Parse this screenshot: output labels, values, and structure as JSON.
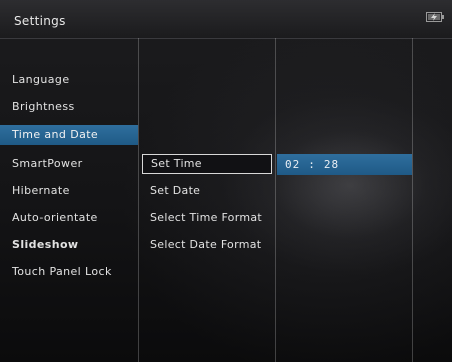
{
  "header": {
    "title": "Settings",
    "battery_icon": "battery-charging-icon"
  },
  "menu": {
    "items": [
      {
        "label": "Language"
      },
      {
        "label": "Brightness"
      },
      {
        "label": "Time and Date",
        "selected": true
      },
      {
        "label": "SmartPower"
      },
      {
        "label": "Hibernate"
      },
      {
        "label": "Auto-orientate"
      },
      {
        "label": "Slideshow"
      },
      {
        "label": "Touch Panel Lock"
      }
    ]
  },
  "submenu": {
    "items": [
      {
        "label": "Set Time",
        "focused": true
      },
      {
        "label": "Set Date"
      },
      {
        "label": "Select Time Format"
      },
      {
        "label": "Select Date Format"
      }
    ]
  },
  "time_setting": {
    "hours": "02",
    "separator": ":",
    "minutes": "28"
  },
  "colors": {
    "selection": "#2a6795",
    "header": "#232325",
    "text": "#e2e2e2"
  }
}
